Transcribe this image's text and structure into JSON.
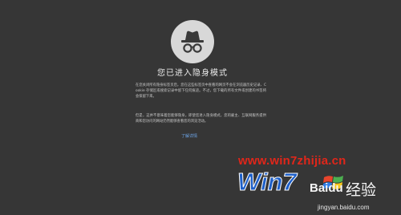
{
  "heading": "您已进入隐身模式",
  "paragraph_1": "在您关闭所有隐身标签页后，您在这些标签页中查看的网页不会在浏览器历史记录、Cookie 存储区或搜索记录中留下任何痕迹。不过，您下载的所有文件或创建的书签将会保留下来。",
  "paragraph_2": "但是，这并不意味着您能够隐身。即使您进入隐身模式，您的雇主、互联网服务提供商和您访问的网站仍然能够查看您的浏览活动。",
  "learn_more_link": "了解详情",
  "watermark": {
    "site_url": "www.win7zhijia.cn",
    "logo_text": "Win7",
    "baidu_label": "Baidu",
    "jingyan_label": "经验",
    "baidu_url": "jingyan.baidu.com"
  },
  "colors": {
    "background": "#363636",
    "icon_circle": "#d8d8d8",
    "link": "#6ea7ea",
    "watermark_red": "#e0261a",
    "watermark_blue": "#1d5fc8"
  }
}
